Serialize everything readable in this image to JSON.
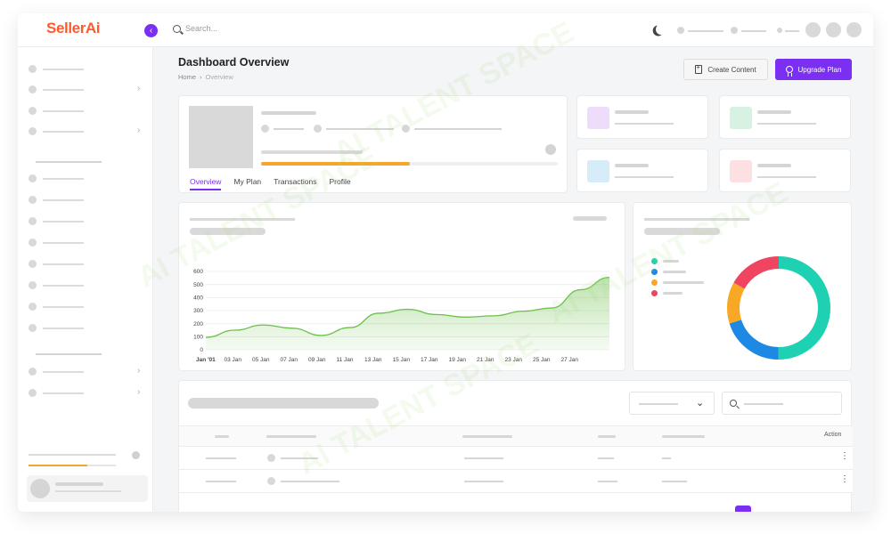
{
  "app": {
    "logo": "SellerAi"
  },
  "topbar": {
    "search_placeholder": "Search..."
  },
  "header": {
    "title": "Dashboard Overview",
    "breadcrumb": [
      "Home",
      "Overview"
    ],
    "breadcrumb_sep": "›",
    "create_label": "Create Content",
    "upgrade_label": "Upgrade Plan"
  },
  "profile": {
    "progress_fraction": 0.5,
    "tabs": [
      "Overview",
      "My Plan",
      "Transactions",
      "Profile"
    ],
    "active_tab": "Overview"
  },
  "stat_swatches": [
    "#eedcfb",
    "#d7f2e2",
    "#d6ecfb",
    "#fde0e2"
  ],
  "chart_data": {
    "type": "area",
    "x": [
      "Jan '01",
      "03 Jan",
      "05 Jan",
      "07 Jan",
      "09 Jan",
      "11 Jan",
      "13 Jan",
      "15 Jan",
      "17 Jan",
      "19 Jan",
      "21 Jan",
      "23 Jan",
      "25 Jan",
      "27 Jan"
    ],
    "yticks": [
      0,
      100,
      200,
      300,
      400,
      500,
      600
    ],
    "ylim": [
      0,
      600
    ],
    "values": [
      95,
      150,
      190,
      165,
      110,
      170,
      280,
      310,
      270,
      250,
      260,
      295,
      320,
      460,
      555
    ],
    "color": "#6cc04a",
    "grid": true
  },
  "donut": {
    "type": "pie",
    "colors": [
      "#1dd1b2",
      "#1e88e5",
      "#f9a825",
      "#ef4560"
    ],
    "values": [
      50,
      20,
      13,
      17
    ]
  },
  "table": {
    "actions_label": "Action",
    "rows": 2,
    "accent": "#7b2ff2"
  },
  "sidebar": {
    "progress_fraction": 0.67
  },
  "colors": {
    "accent": "#7b2ff2",
    "brand": "#ff5a2c",
    "progress": "#f4a62a"
  },
  "watermark": "AI TALENT SPACE"
}
